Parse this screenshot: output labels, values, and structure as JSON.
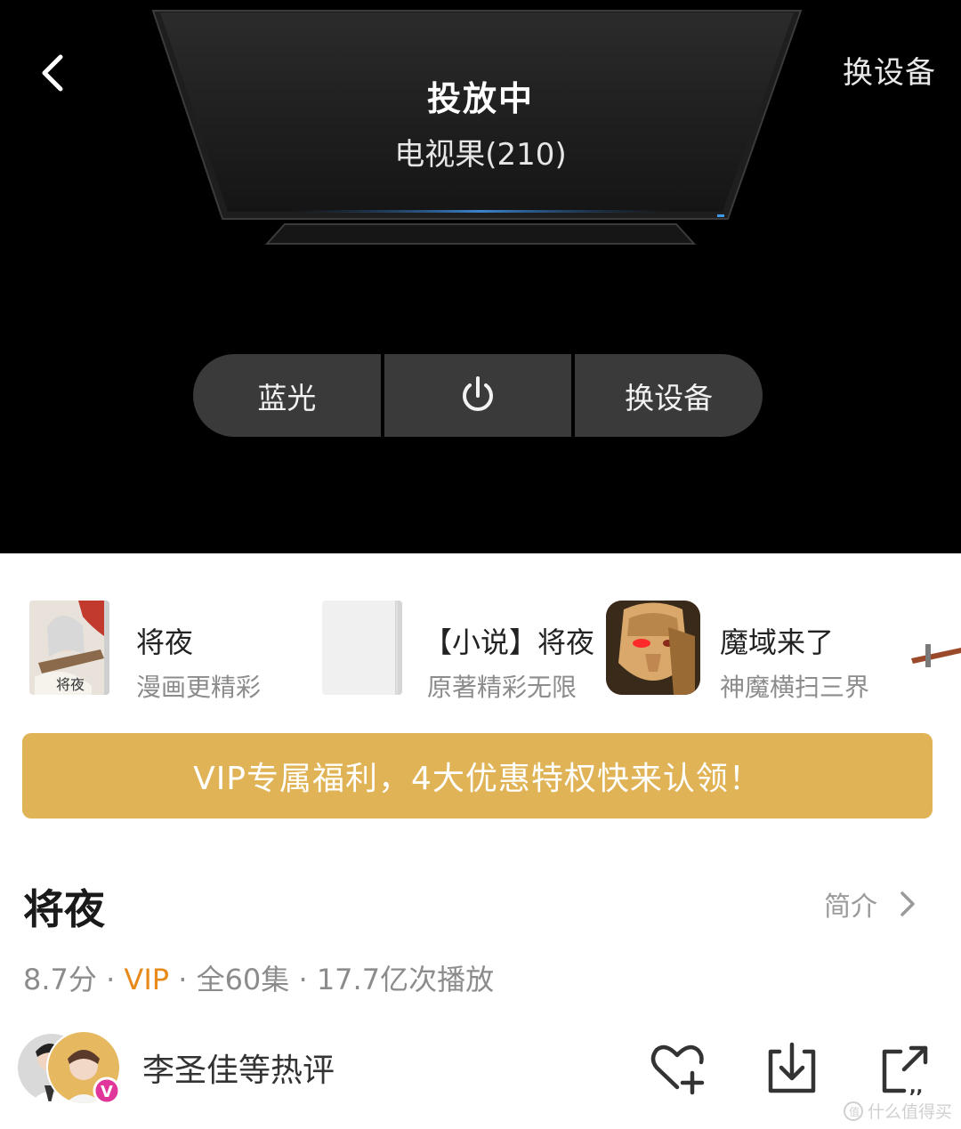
{
  "cast": {
    "status": "投放中",
    "device": "电视果(210)",
    "switch_device_top": "换设备",
    "controls": [
      {
        "label": "蓝光"
      },
      {
        "label": "",
        "icon": "power-icon"
      },
      {
        "label": "换设备"
      }
    ]
  },
  "recommendations": [
    {
      "title": "将夜",
      "subtitle": "漫画更精彩",
      "icon": "comic-cover-thumbnail"
    },
    {
      "title": "【小说】将夜",
      "subtitle": "原著精彩无限",
      "icon": "novel-cover-thumbnail"
    },
    {
      "title": "魔域来了",
      "subtitle": "神魔横扫三界",
      "icon": "game-icon"
    }
  ],
  "vip_banner": "VIP专属福利，4大优惠特权快来认领！",
  "show": {
    "title": "将夜",
    "intro_label": "简介",
    "score": "8.7分",
    "sep": " · ",
    "vip": "VIP",
    "episodes": "全60集",
    "plays": "17.7亿次播放"
  },
  "reviews_label": "李圣佳等热评",
  "actions": [
    "favorite-add-icon",
    "download-icon",
    "share-icon"
  ],
  "watermark": "什么值得买",
  "colors": {
    "dark_bg": "#000000",
    "control_bg": "#3a3a3a",
    "vip_gold": "#e0b456",
    "vip_orange": "#e88a1a",
    "badge_pink": "#e0369a"
  }
}
